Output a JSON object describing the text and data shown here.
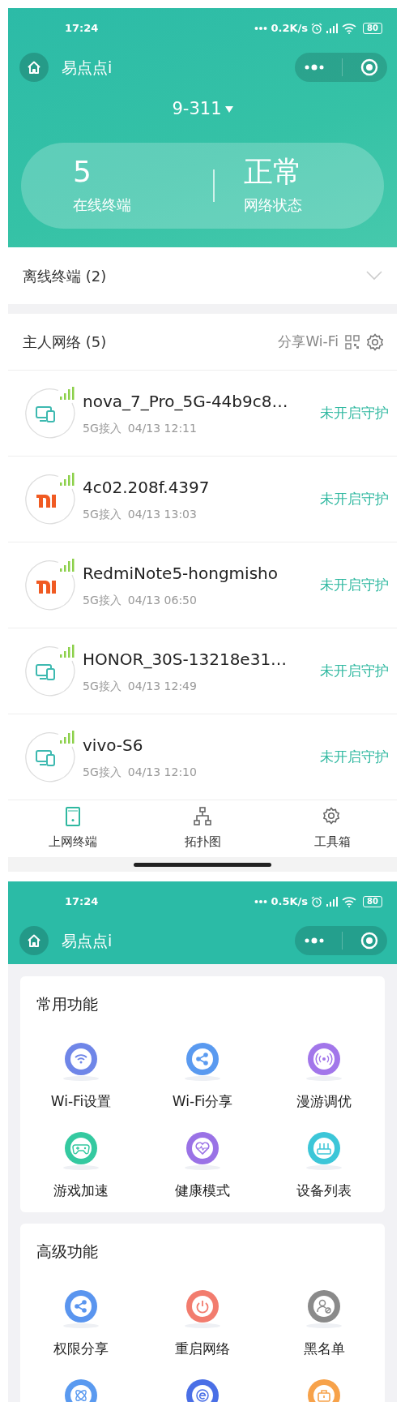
{
  "screen_1": {
    "status_bar": {
      "time": "17:24",
      "speed": "0.2K/s",
      "battery": "80"
    },
    "app_title": "易点点i",
    "router": "9-311",
    "stats": [
      {
        "value": "5",
        "label": "在线终端"
      },
      {
        "value": "正常",
        "label": "网络状态"
      }
    ],
    "offline": {
      "label": "离线终端 (2)",
      "expanded": false
    },
    "host_network": {
      "title": "主人网络 (5)",
      "share_label": "分享Wi-Fi"
    },
    "devices": [
      {
        "kind": "device",
        "name": "nova_7_Pro_5G-44b9c8…",
        "access": "5G接入",
        "time": "04/13 12:11",
        "status": "未开启守护"
      },
      {
        "kind": "mi",
        "name": "4c02.208f.4397",
        "access": "5G接入",
        "time": "04/13 13:03",
        "status": "未开启守护"
      },
      {
        "kind": "mi",
        "name": "RedmiNote5-hongmisho",
        "access": "5G接入",
        "time": "04/13 06:50",
        "status": "未开启守护"
      },
      {
        "kind": "device",
        "name": "HONOR_30S-13218e31…",
        "access": "5G接入",
        "time": "04/13 12:49",
        "status": "未开启守护"
      },
      {
        "kind": "device",
        "name": "vivo-S6",
        "access": "5G接入",
        "time": "04/13 12:10",
        "status": "未开启守护"
      }
    ],
    "tabs": [
      {
        "kind": "phone",
        "label": "上网终端",
        "selected": true
      },
      {
        "kind": "topology",
        "label": "拓扑图",
        "selected": false
      },
      {
        "kind": "gear",
        "label": "工具箱",
        "selected": false
      }
    ]
  },
  "screen_2": {
    "status_bar": {
      "time": "17:24",
      "speed": "0.5K/s",
      "battery": "80"
    },
    "app_title": "易点点i",
    "sections": [
      {
        "title": "常用功能",
        "items": [
          {
            "kind": "wifi",
            "label": "Wi-Fi设置",
            "color": "#6f86e8"
          },
          {
            "kind": "share",
            "label": "Wi-Fi分享",
            "color": "#5a9af0"
          },
          {
            "kind": "signal",
            "label": "漫游调优",
            "color": "#a276ea"
          },
          {
            "kind": "gamepad",
            "label": "游戏加速",
            "color": "#34c9a0"
          },
          {
            "kind": "heart",
            "label": "健康模式",
            "color": "#9a72e6"
          },
          {
            "kind": "router",
            "label": "设备列表",
            "color": "#3cc6d8"
          }
        ]
      },
      {
        "title": "高级功能",
        "items": [
          {
            "kind": "share",
            "label": "权限分享",
            "color": "#5a95ef"
          },
          {
            "kind": "power",
            "label": "重启网络",
            "color": "#f27c6e"
          },
          {
            "kind": "user",
            "label": "黑名单",
            "color": "#8a8a8a"
          },
          {
            "kind": "atom",
            "color": "#5a9af0"
          },
          {
            "kind": "e",
            "color": "#4a6fe6"
          },
          {
            "kind": "bag",
            "color": "#f7a24a"
          }
        ]
      }
    ]
  }
}
